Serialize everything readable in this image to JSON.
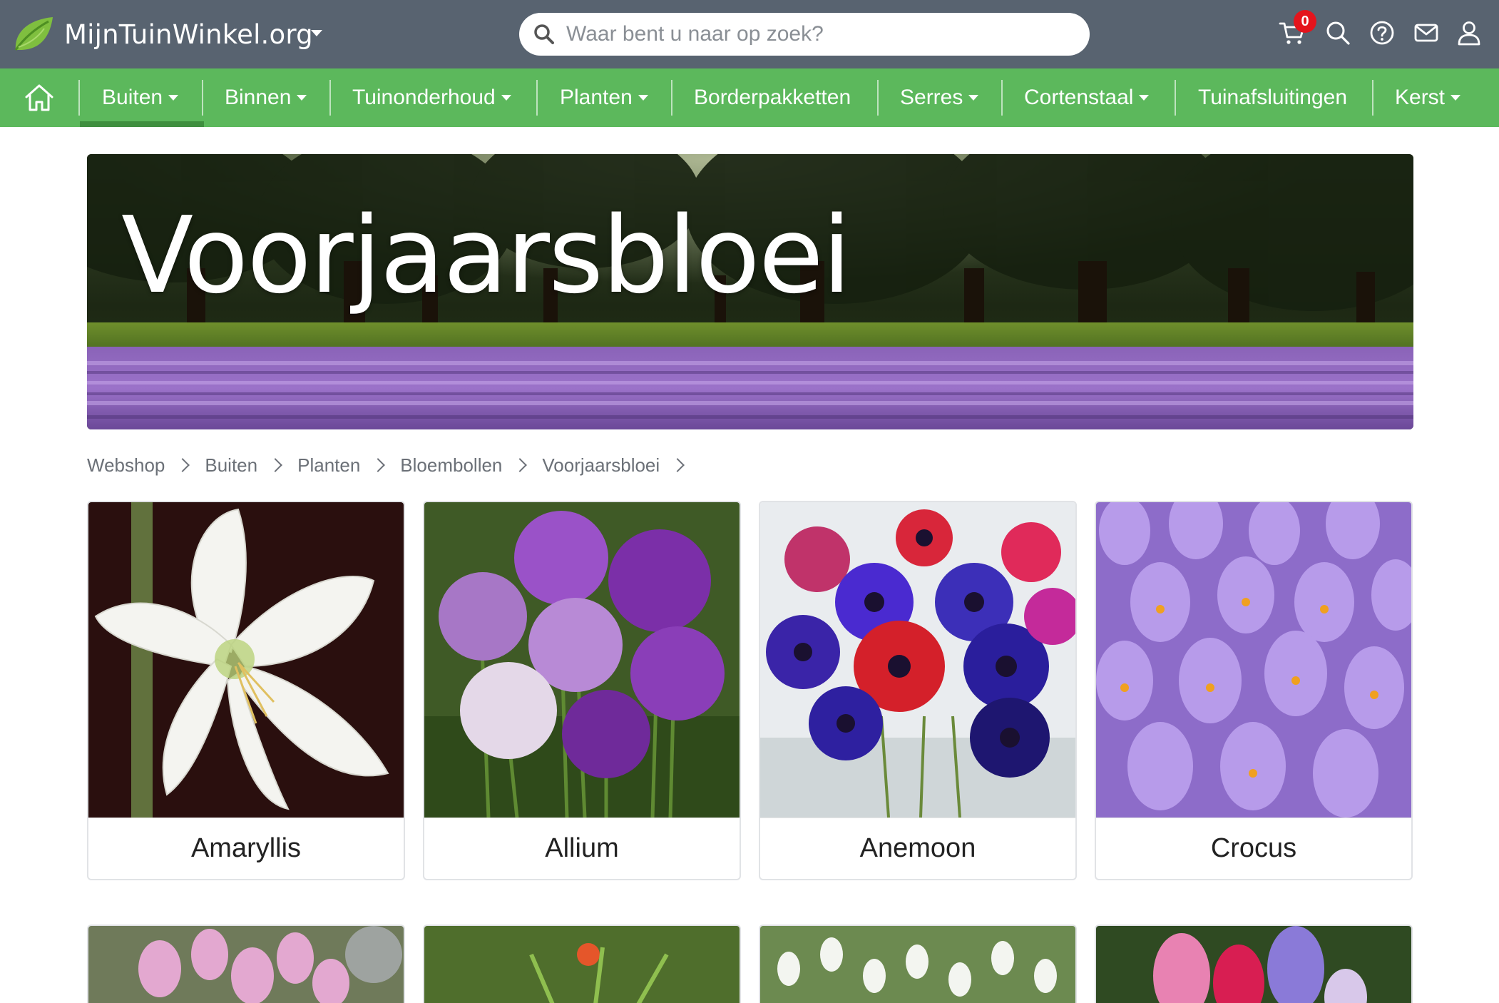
{
  "header": {
    "logo_text": "MijnTuinWinkel.org",
    "search_placeholder": "Waar bent u naar op zoek?",
    "cart_count": "0",
    "icons": [
      "cart-icon",
      "search-icon",
      "help-icon",
      "mail-icon",
      "user-icon"
    ]
  },
  "nav": {
    "items": [
      {
        "label": "Buiten",
        "dropdown": true,
        "active": true
      },
      {
        "label": "Binnen",
        "dropdown": true
      },
      {
        "label": "Tuinonderhoud",
        "dropdown": true
      },
      {
        "label": "Planten",
        "dropdown": true
      },
      {
        "label": "Borderpakketten",
        "dropdown": false
      },
      {
        "label": "Serres",
        "dropdown": true
      },
      {
        "label": "Cortenstaal",
        "dropdown": true
      },
      {
        "label": "Tuinafsluitingen",
        "dropdown": false
      },
      {
        "label": "Kerst",
        "dropdown": true
      }
    ]
  },
  "banner": {
    "title": "Voorjaarsbloei"
  },
  "breadcrumb": [
    "Webshop",
    "Buiten",
    "Planten",
    "Bloembollen",
    "Voorjaarsbloei"
  ],
  "categories": [
    {
      "label": "Amaryllis"
    },
    {
      "label": "Allium"
    },
    {
      "label": "Anemoon"
    },
    {
      "label": "Crocus"
    }
  ],
  "colors": {
    "topbar": "#586370",
    "nav": "#5cb85c",
    "nav_active": "#3f8f3f",
    "badge": "#e4141c"
  }
}
